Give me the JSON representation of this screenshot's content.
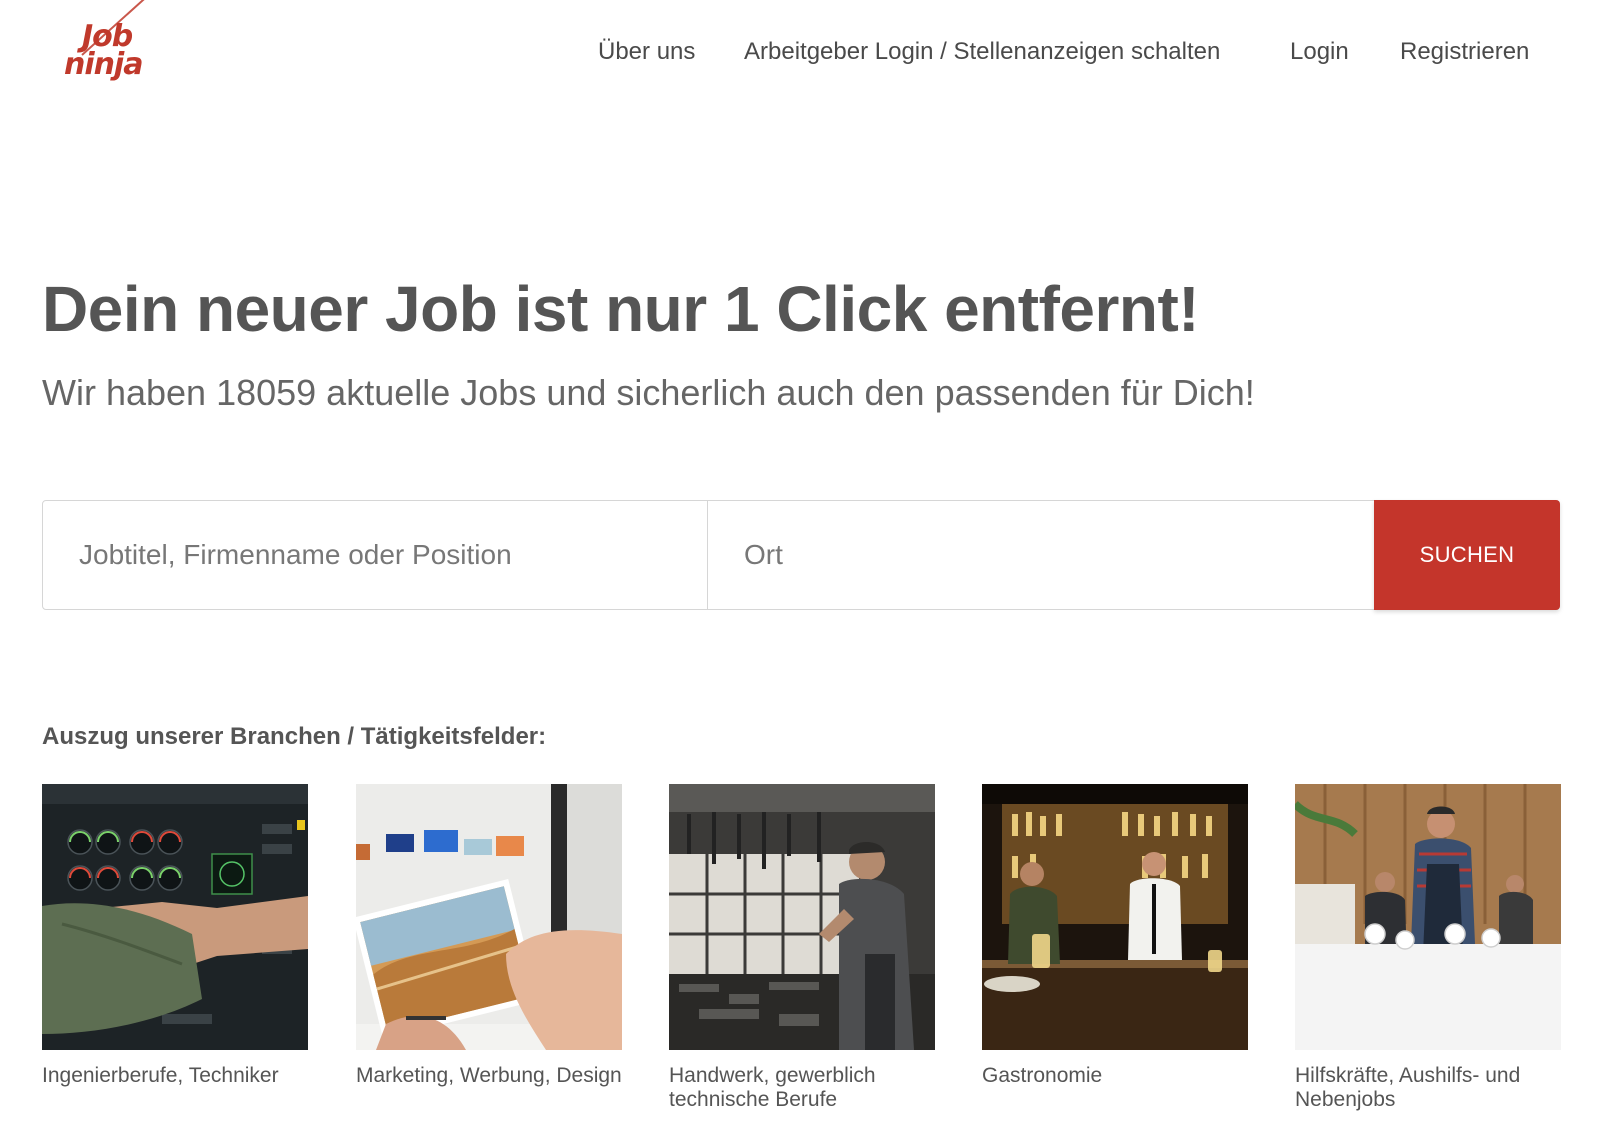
{
  "brand": {
    "logo_line1": "Job",
    "logo_line2": "ninja",
    "accent_color": "#c4352b"
  },
  "nav": {
    "items": [
      {
        "label": "Über uns"
      },
      {
        "label": "Arbeitgeber Login / Stellenanzeigen schalten"
      },
      {
        "label": "Login"
      },
      {
        "label": "Registrieren"
      }
    ]
  },
  "hero": {
    "title": "Dein neuer Job ist nur 1 Click entfernt!",
    "subtitle": "Wir haben 18059 aktuelle Jobs und sicherlich auch den passenden für Dich!"
  },
  "search": {
    "job_placeholder": "Jobtitel, Firmenname oder Position",
    "job_value": "",
    "location_placeholder": "Ort",
    "location_value": "",
    "button_label": "SUCHEN"
  },
  "categories": {
    "heading": "Auszug unserer Branchen / Tätigkeitsfelder:",
    "items": [
      {
        "label": "Ingenierberufe, Techniker",
        "image": "cockpit-photo"
      },
      {
        "label": "Marketing, Werbung, Design",
        "image": "design-photo"
      },
      {
        "label": "Handwerk, gewerblich technische Berufe",
        "image": "workshop-photo"
      },
      {
        "label": "Gastronomie",
        "image": "bar-photo"
      },
      {
        "label": "Hilfskräfte, Aushilfs- und Nebenjobs",
        "image": "barista-photo"
      }
    ]
  }
}
